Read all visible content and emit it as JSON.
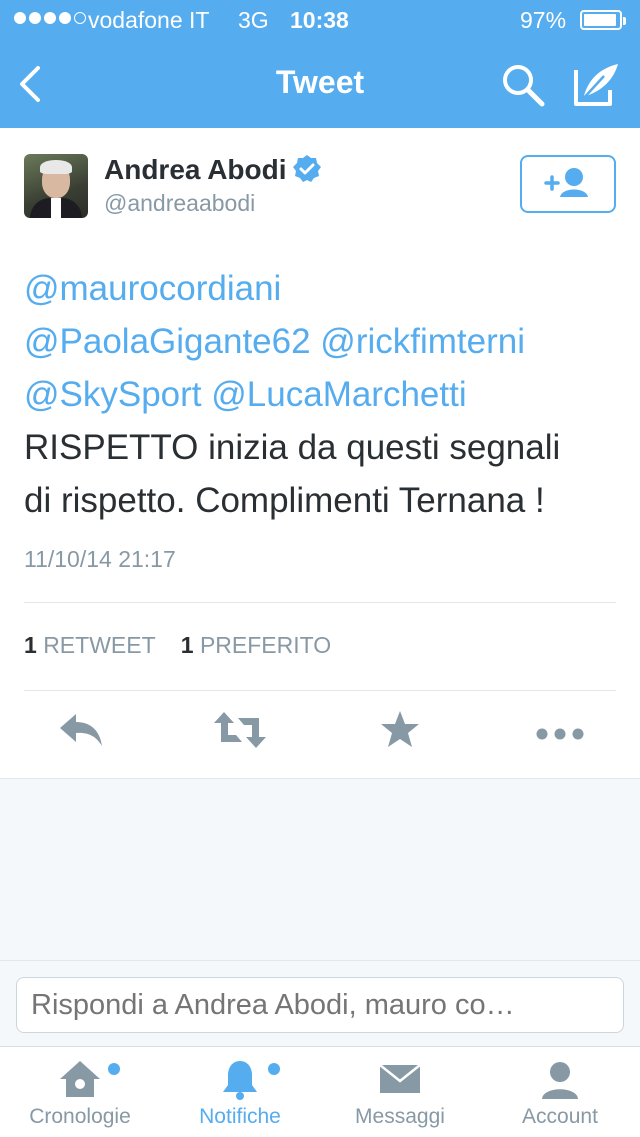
{
  "status_bar": {
    "carrier": "vodafone IT",
    "network": "3G",
    "time": "10:38",
    "battery": "97%",
    "battery_level": 0.97,
    "signal_bars": 4
  },
  "nav": {
    "title": "Tweet"
  },
  "tweet": {
    "author_name": "Andrea Abodi",
    "author_handle": "@andreaabodi",
    "verified": true,
    "text_lines": [
      [
        {
          "t": "@maurocordiani",
          "m": true
        }
      ],
      [
        {
          "t": "@PaolaGigante62",
          "m": true
        },
        {
          "t": " ",
          "m": false
        },
        {
          "t": "@rickfimterni",
          "m": true
        }
      ],
      [
        {
          "t": "@SkySport",
          "m": true
        },
        {
          "t": " ",
          "m": false
        },
        {
          "t": "@LucaMarchetti",
          "m": true
        }
      ],
      [
        {
          "t": "RISPETTO inizia da questi segnali",
          "m": false
        }
      ],
      [
        {
          "t": "di rispetto. Complimenti Ternana !",
          "m": false
        }
      ]
    ],
    "timestamp": "11/10/14 21:17",
    "retweet_count": "1",
    "retweet_label": "RETWEET",
    "favorite_count": "1",
    "favorite_label": "PREFERITO"
  },
  "reply": {
    "placeholder": "Rispondi a Andrea Abodi, mauro co…"
  },
  "tabs": [
    {
      "label": "Cronologie",
      "icon": "home-icon",
      "badge": true,
      "active": false
    },
    {
      "label": "Notifiche",
      "icon": "bell-icon",
      "badge": true,
      "active": true
    },
    {
      "label": "Messaggi",
      "icon": "envelope-icon",
      "badge": false,
      "active": false
    },
    {
      "label": "Account",
      "icon": "person-icon",
      "badge": false,
      "active": false
    }
  ],
  "colors": {
    "accent": "#55acee",
    "text": "#292f33",
    "muted": "#8899a6",
    "action_icon": "#8899a6"
  }
}
